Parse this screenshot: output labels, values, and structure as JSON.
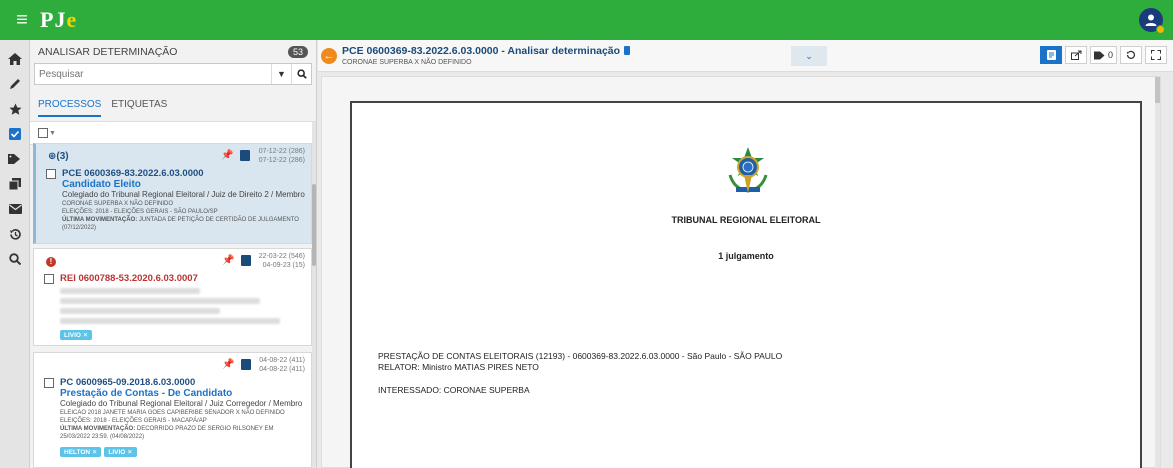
{
  "app": {
    "logo_p": "P",
    "logo_j": "J",
    "logo_e": "e"
  },
  "sidebar_icons": [
    "home-icon",
    "pencil-icon",
    "star-icon",
    "checkbox-icon",
    "tags-icon",
    "copy-icon",
    "envelope-icon",
    "history-icon",
    "search-icon"
  ],
  "panel": {
    "title": "ANALISAR DETERMINAÇÃO",
    "count": "53",
    "search_placeholder": "Pesquisar",
    "tabs": [
      "PROCESSOS",
      "ETIQUETAS"
    ]
  },
  "cards": [
    {
      "badge": "(3)",
      "date1": "07-12-22 (286)",
      "date2": "07-12-22 (286)",
      "number": "PCE 0600369-83.2022.6.03.0000",
      "class": "Candidato Eleito",
      "org": "Colegiado do Tribunal Regional Eleitoral / Juiz de Direito 2 / Membro",
      "parties": "CORONAE SUPERBA X NÃO DEFINIDO",
      "election": "ELEIÇÕES: 2018 - ELEIÇÕES GERAIS - SÃO PAULO/SP",
      "last_label": "ÚLTIMA MOVIMENTAÇÃO:",
      "last_text": "JUNTADA DE PETIÇÃO DE CERTIDÃO DE JULGAMENTO (07/12/2022)"
    },
    {
      "date1": "22-03-22 (546)",
      "date2": "04-09-23 (15)",
      "number": "REI 0600788-53.2020.6.03.0007",
      "tag": "LIVIO ✕"
    },
    {
      "date1": "04-08-22 (411)",
      "date2": "04-08-22 (411)",
      "number": "PC 0600965-09.2018.6.03.0000",
      "class": "Prestação de Contas - De Candidato",
      "org": "Colegiado do Tribunal Regional Eleitoral / Juiz Corregedor / Membro",
      "parties": "ELEICAO 2018 JANETE MARIA GOES CAPIBERIBE SENADOR X NÃO DEFINIDO",
      "election": "ELEIÇÕES: 2018 - ELEIÇÕES GERAIS - MACAPÁ/AP",
      "last_label": "ÚLTIMA MOVIMENTAÇÃO:",
      "last_text": "DECORRIDO PRAZO DE SERGIO RILSONEY EM 25/03/2022 23:59. (04/08/2022)",
      "tags": [
        "HELTON ✕",
        "LIVIO ✕"
      ]
    }
  ],
  "main": {
    "title": "PCE 0600369-83.2022.6.03.0000 - Analisar determinação",
    "subtitle": "CORONAE SUPERBA X NÃO DEFINIDO",
    "toolbar_count": "0"
  },
  "document": {
    "court": "TRIBUNAL REGIONAL ELEITORAL",
    "heading": "1 julgamento",
    "line1": "PRESTAÇÃO DE CONTAS ELEITORAIS (12193) - 0600369-83.2022.6.03.0000 - São Paulo - SÃO PAULO",
    "line2": "RELATOR: Ministro MATIAS PIRES NETO",
    "line3": "INTERESSADO: CORONAE SUPERBA"
  }
}
